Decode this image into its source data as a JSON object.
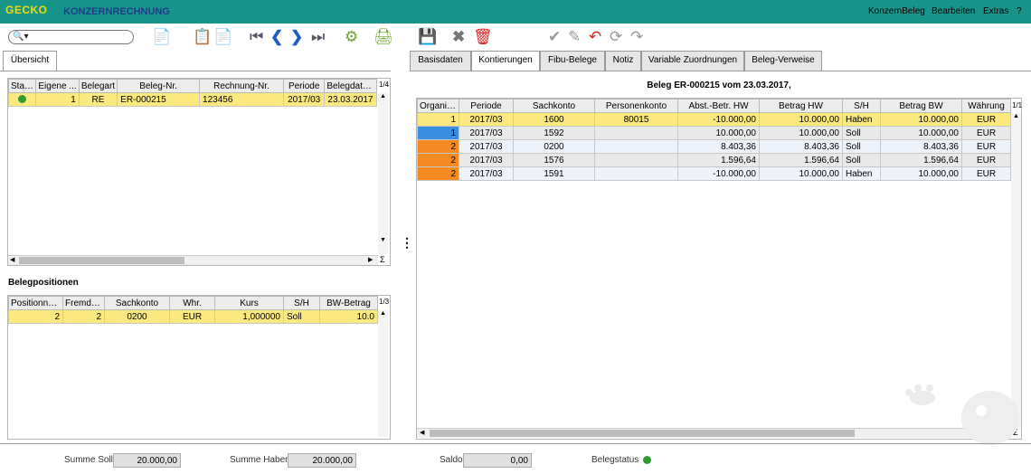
{
  "app": {
    "logo": "GECKO",
    "title": "KONZERNRECHNUNG",
    "menu": [
      "KonzernBeleg",
      "Bearbeiten",
      "Extras",
      "?"
    ]
  },
  "left_tab": "Übersicht",
  "overview": {
    "page_indicator": "1/4",
    "columns": [
      "Status",
      "Eigene ...",
      "Belegart",
      "Beleg-Nr.",
      "Rechnung-Nr.",
      "Periode",
      "Belegdatum"
    ],
    "rows": [
      {
        "status": "green",
        "eigene": "1",
        "belegart": "RE",
        "beleg_nr": "ER-000215",
        "rechnung_nr": "123456",
        "periode": "2017/03",
        "belegdatum": "23.03.2017"
      }
    ]
  },
  "positions": {
    "title": "Belegpositionen",
    "page_indicator": "1/3",
    "columns": [
      "Positionnu...",
      "Fremde ...",
      "Sachkonto",
      "Whr.",
      "Kurs",
      "S/H",
      "BW-Betrag"
    ],
    "rows": [
      {
        "pos": "2",
        "fremde": "2",
        "sachkonto": "0200",
        "whr": "EUR",
        "kurs": "1,000000",
        "sh": "Soll",
        "bw": "10.0"
      }
    ]
  },
  "right_tabs": [
    "Basisdaten",
    "Kontierungen",
    "Fibu-Belege",
    "Notiz",
    "Variable Zuordnungen",
    "Beleg-Verweise"
  ],
  "active_right_tab": "Kontierungen",
  "kontierung": {
    "header": "Beleg ER-000215 vom 23.03.2017,",
    "page_indicator": "1/1",
    "columns": [
      "Organis...",
      "Periode",
      "Sachkonto",
      "Personenkonto",
      "Abst.-Betr. HW",
      "Betrag HW",
      "S/H",
      "Betrag BW",
      "Währung"
    ],
    "rows": [
      {
        "org": "1",
        "periode": "2017/03",
        "sachkonto": "1600",
        "personenkonto": "80015",
        "abst": "-10.000,00",
        "betrag_hw": "10.000,00",
        "sh": "Haben",
        "betrag_bw": "10.000,00",
        "waehrung": "EUR",
        "org_color": "#fbe97f"
      },
      {
        "org": "1",
        "periode": "2017/03",
        "sachkonto": "1592",
        "personenkonto": "",
        "abst": "10.000,00",
        "betrag_hw": "10.000,00",
        "sh": "Soll",
        "betrag_bw": "10.000,00",
        "waehrung": "EUR",
        "org_color": "#3a8de0"
      },
      {
        "org": "2",
        "periode": "2017/03",
        "sachkonto": "0200",
        "personenkonto": "",
        "abst": "8.403,36",
        "betrag_hw": "8.403,36",
        "sh": "Soll",
        "betrag_bw": "8.403,36",
        "waehrung": "EUR",
        "org_color": "#f58a22"
      },
      {
        "org": "2",
        "periode": "2017/03",
        "sachkonto": "1576",
        "personenkonto": "",
        "abst": "1.596,64",
        "betrag_hw": "1.596,64",
        "sh": "Soll",
        "betrag_bw": "1.596,64",
        "waehrung": "EUR",
        "org_color": "#f58a22"
      },
      {
        "org": "2",
        "periode": "2017/03",
        "sachkonto": "1591",
        "personenkonto": "",
        "abst": "-10.000,00",
        "betrag_hw": "10.000,00",
        "sh": "Haben",
        "betrag_bw": "10.000,00",
        "waehrung": "EUR",
        "org_color": "#f58a22"
      }
    ]
  },
  "footer": {
    "summe_soll_label": "Summe Soll",
    "summe_soll": "20.000,00",
    "summe_haben_label": "Summe Haben",
    "summe_haben": "20.000,00",
    "saldo_label": "Saldo",
    "saldo": "0,00",
    "belegstatus_label": "Belegstatus"
  },
  "sigma": "Σ",
  "colors": {
    "header_bg": "#17958b",
    "selected_row": "#fbe97f",
    "status_green": "#2e9d2e"
  }
}
